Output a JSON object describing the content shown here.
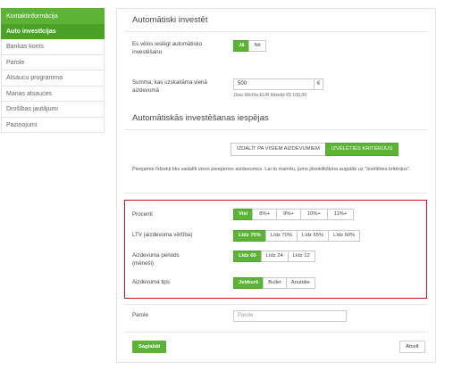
{
  "sidebar": {
    "items": [
      {
        "label": "Kontaktinformācija"
      },
      {
        "label": "Auto investīcijas"
      },
      {
        "label": "Bankas konts"
      },
      {
        "label": "Parole"
      },
      {
        "label": "Atsaucu programma"
      },
      {
        "label": "Manas atsauces"
      },
      {
        "label": "Drošības jautājumi"
      },
      {
        "label": "Paziņojumi"
      }
    ]
  },
  "auto_invest": {
    "title": "Automātiski investēt",
    "enable_label": "Es vēlos ieslēgt automātisko investēšanu",
    "enable_options": [
      "Jā",
      "Nē"
    ],
    "amount_label": "Summa, kas uzskaitāma vienā aizdevumā",
    "amount_value": "500",
    "amount_currency": "€",
    "amount_hint": "Jūsu šībrīža EUR līdzekļi €5 100,00"
  },
  "settings": {
    "title": "Automātiskās investēšanas iespējas",
    "mode_options": [
      "IZDALĪT PA VISIEM AIZDEVUMIEM",
      "IZVĒLĒTIES KRITĒRIJUS"
    ],
    "description": "Pieejamie līdzekļi tiks sadalīti visos pieejamos aizdevumos. Lai to mainītu, jums jānoklikšķina augstāk uz \"Izvēlēties kritērijus\"."
  },
  "criteria": {
    "interest_label": "Procenti",
    "interest_options": [
      "Visi",
      "8%+",
      "9%+",
      "10%+",
      "11%+"
    ],
    "ltv_label": "LTV (aizdevuma vērtība)",
    "ltv_options": [
      "Līdz 75%",
      "Līdz 70%",
      "Līdz 65%",
      "Līdz 60%"
    ],
    "period_label": "Aizdevuma periods (mēneši)",
    "period_options": [
      "Līdz 60",
      "Līdz 24",
      "Līdz 12"
    ],
    "type_label": "Aizdevuma tips",
    "type_options": [
      "Jebkurš",
      "Bullet",
      "Anuitāte"
    ]
  },
  "password": {
    "label": "Parole",
    "placeholder": "Parole"
  },
  "actions": {
    "save_label": "Saglabāt",
    "cancel_label": "Atcelt"
  },
  "colors": {
    "accent": "#5cb335",
    "highlight_border": "#c9131b"
  }
}
